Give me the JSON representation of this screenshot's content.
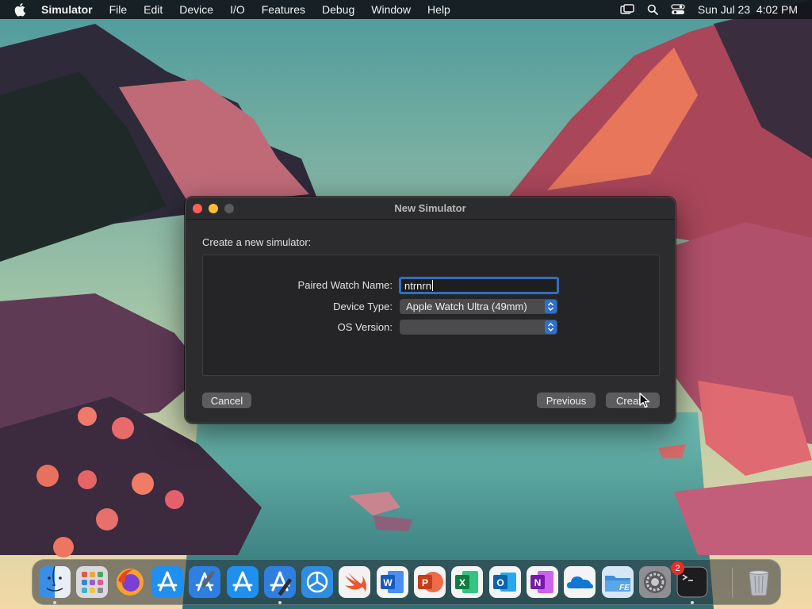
{
  "menubar": {
    "app_name": "Simulator",
    "items": [
      "File",
      "Edit",
      "Device",
      "I/O",
      "Features",
      "Debug",
      "Window",
      "Help"
    ],
    "clock": "Sun Jul 23  4:02 PM"
  },
  "dialog": {
    "title": "New Simulator",
    "intro": "Create a new simulator:",
    "fields": {
      "paired_watch_name_label": "Paired Watch Name:",
      "paired_watch_name_value": "ntrnrn",
      "device_type_label": "Device Type:",
      "device_type_value": "Apple Watch Ultra (49mm)",
      "os_version_label": "OS Version:",
      "os_version_value": ""
    },
    "buttons": {
      "cancel": "Cancel",
      "previous": "Previous",
      "create": "Create"
    }
  },
  "dock": {
    "apps": [
      {
        "name": "finder-icon",
        "color": "#3a8ee6"
      },
      {
        "name": "launchpad-icon",
        "color": "#d9d9de"
      },
      {
        "name": "firefox-icon",
        "color": "#e8571f"
      },
      {
        "name": "app-store-icon",
        "color": "#1f8ff0"
      },
      {
        "name": "xcode-icon",
        "color": "#2f7fe0"
      },
      {
        "name": "app-store-icon-2",
        "color": "#1f8ff0"
      },
      {
        "name": "xcode-app-store-icon",
        "color": "#2f7fe0"
      },
      {
        "name": "instruments-icon",
        "color": "#2f8de0"
      },
      {
        "name": "swift-icon",
        "color": "#f2f2f2"
      },
      {
        "name": "word-icon",
        "color": "#f4f4f4"
      },
      {
        "name": "powerpoint-icon",
        "color": "#f4f4f4"
      },
      {
        "name": "excel-icon",
        "color": "#f4f4f4"
      },
      {
        "name": "outlook-icon",
        "color": "#f4f4f4"
      },
      {
        "name": "onenote-icon",
        "color": "#f4f4f4"
      },
      {
        "name": "onedrive-icon",
        "color": "#f4f4f4"
      },
      {
        "name": "file-explorer-icon",
        "color": "#3a8fd8"
      },
      {
        "name": "system-settings-icon",
        "color": "#8e8e93"
      },
      {
        "name": "terminal-icon",
        "color": "#1d1d1f"
      }
    ],
    "trash": {
      "name": "trash-icon"
    },
    "settings_badge": "2"
  }
}
